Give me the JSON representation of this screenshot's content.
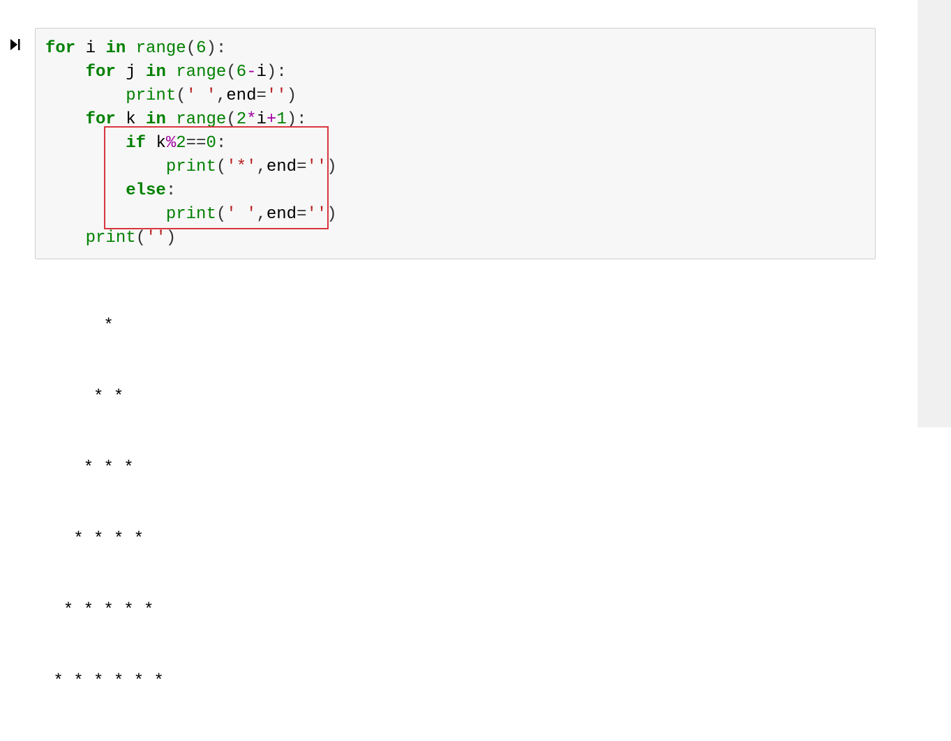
{
  "prompt": {
    "run_icon": "▷|"
  },
  "code": {
    "l1": {
      "kw_for": "for",
      "id_i": " i ",
      "kw_in": "in",
      "sp": " ",
      "fn_range": "range",
      "lp": "(",
      "n6": "6",
      "rp": ")",
      "colon": ":"
    },
    "l2": {
      "indent": "    ",
      "kw_for": "for",
      "id_j": " j ",
      "kw_in": "in",
      "sp": " ",
      "fn_range": "range",
      "lp": "(",
      "n6": "6",
      "minus": "-",
      "id_i": "i",
      "rp": ")",
      "colon": ":"
    },
    "l3": {
      "indent": "        ",
      "fn_print": "print",
      "lp": "(",
      "s1": "' '",
      "comma": ",",
      "id_end": "end",
      "eq": "=",
      "s2": "''",
      "rp": ")"
    },
    "l4": {
      "indent": "    ",
      "kw_for": "for",
      "id_k": " k ",
      "kw_in": "in",
      "sp": " ",
      "fn_range": "range",
      "lp": "(",
      "n2": "2",
      "mul": "*",
      "id_i": "i",
      "plus": "+",
      "n1": "1",
      "rp": ")",
      "colon": ":"
    },
    "l5": {
      "indent": "        ",
      "kw_if": "if",
      "sp": " ",
      "id_k": "k",
      "mod": "%",
      "n2": "2",
      "eqeq": "==",
      "n0": "0",
      "colon": ":"
    },
    "l6": {
      "indent": "            ",
      "fn_print": "print",
      "lp": "(",
      "s1": "'*'",
      "comma": ",",
      "id_end": "end",
      "eq": "=",
      "s2": "''",
      "rp": ")"
    },
    "l7": {
      "indent": "        ",
      "kw_else": "else",
      "colon": ":"
    },
    "l8": {
      "indent": "            ",
      "fn_print": "print",
      "lp": "(",
      "s1": "' '",
      "comma": ",",
      "id_end": "end",
      "eq": "=",
      "s2": "''",
      "rp": ")"
    },
    "l9": {
      "indent": "    ",
      "fn_print": "print",
      "lp": "(",
      "s1": "''",
      "rp": ")"
    }
  },
  "output": {
    "line1": "      *",
    "line2": "     * *",
    "line3": "    * * *",
    "line4": "   * * * *",
    "line5": "  * * * * *",
    "line6": " * * * * * *"
  }
}
